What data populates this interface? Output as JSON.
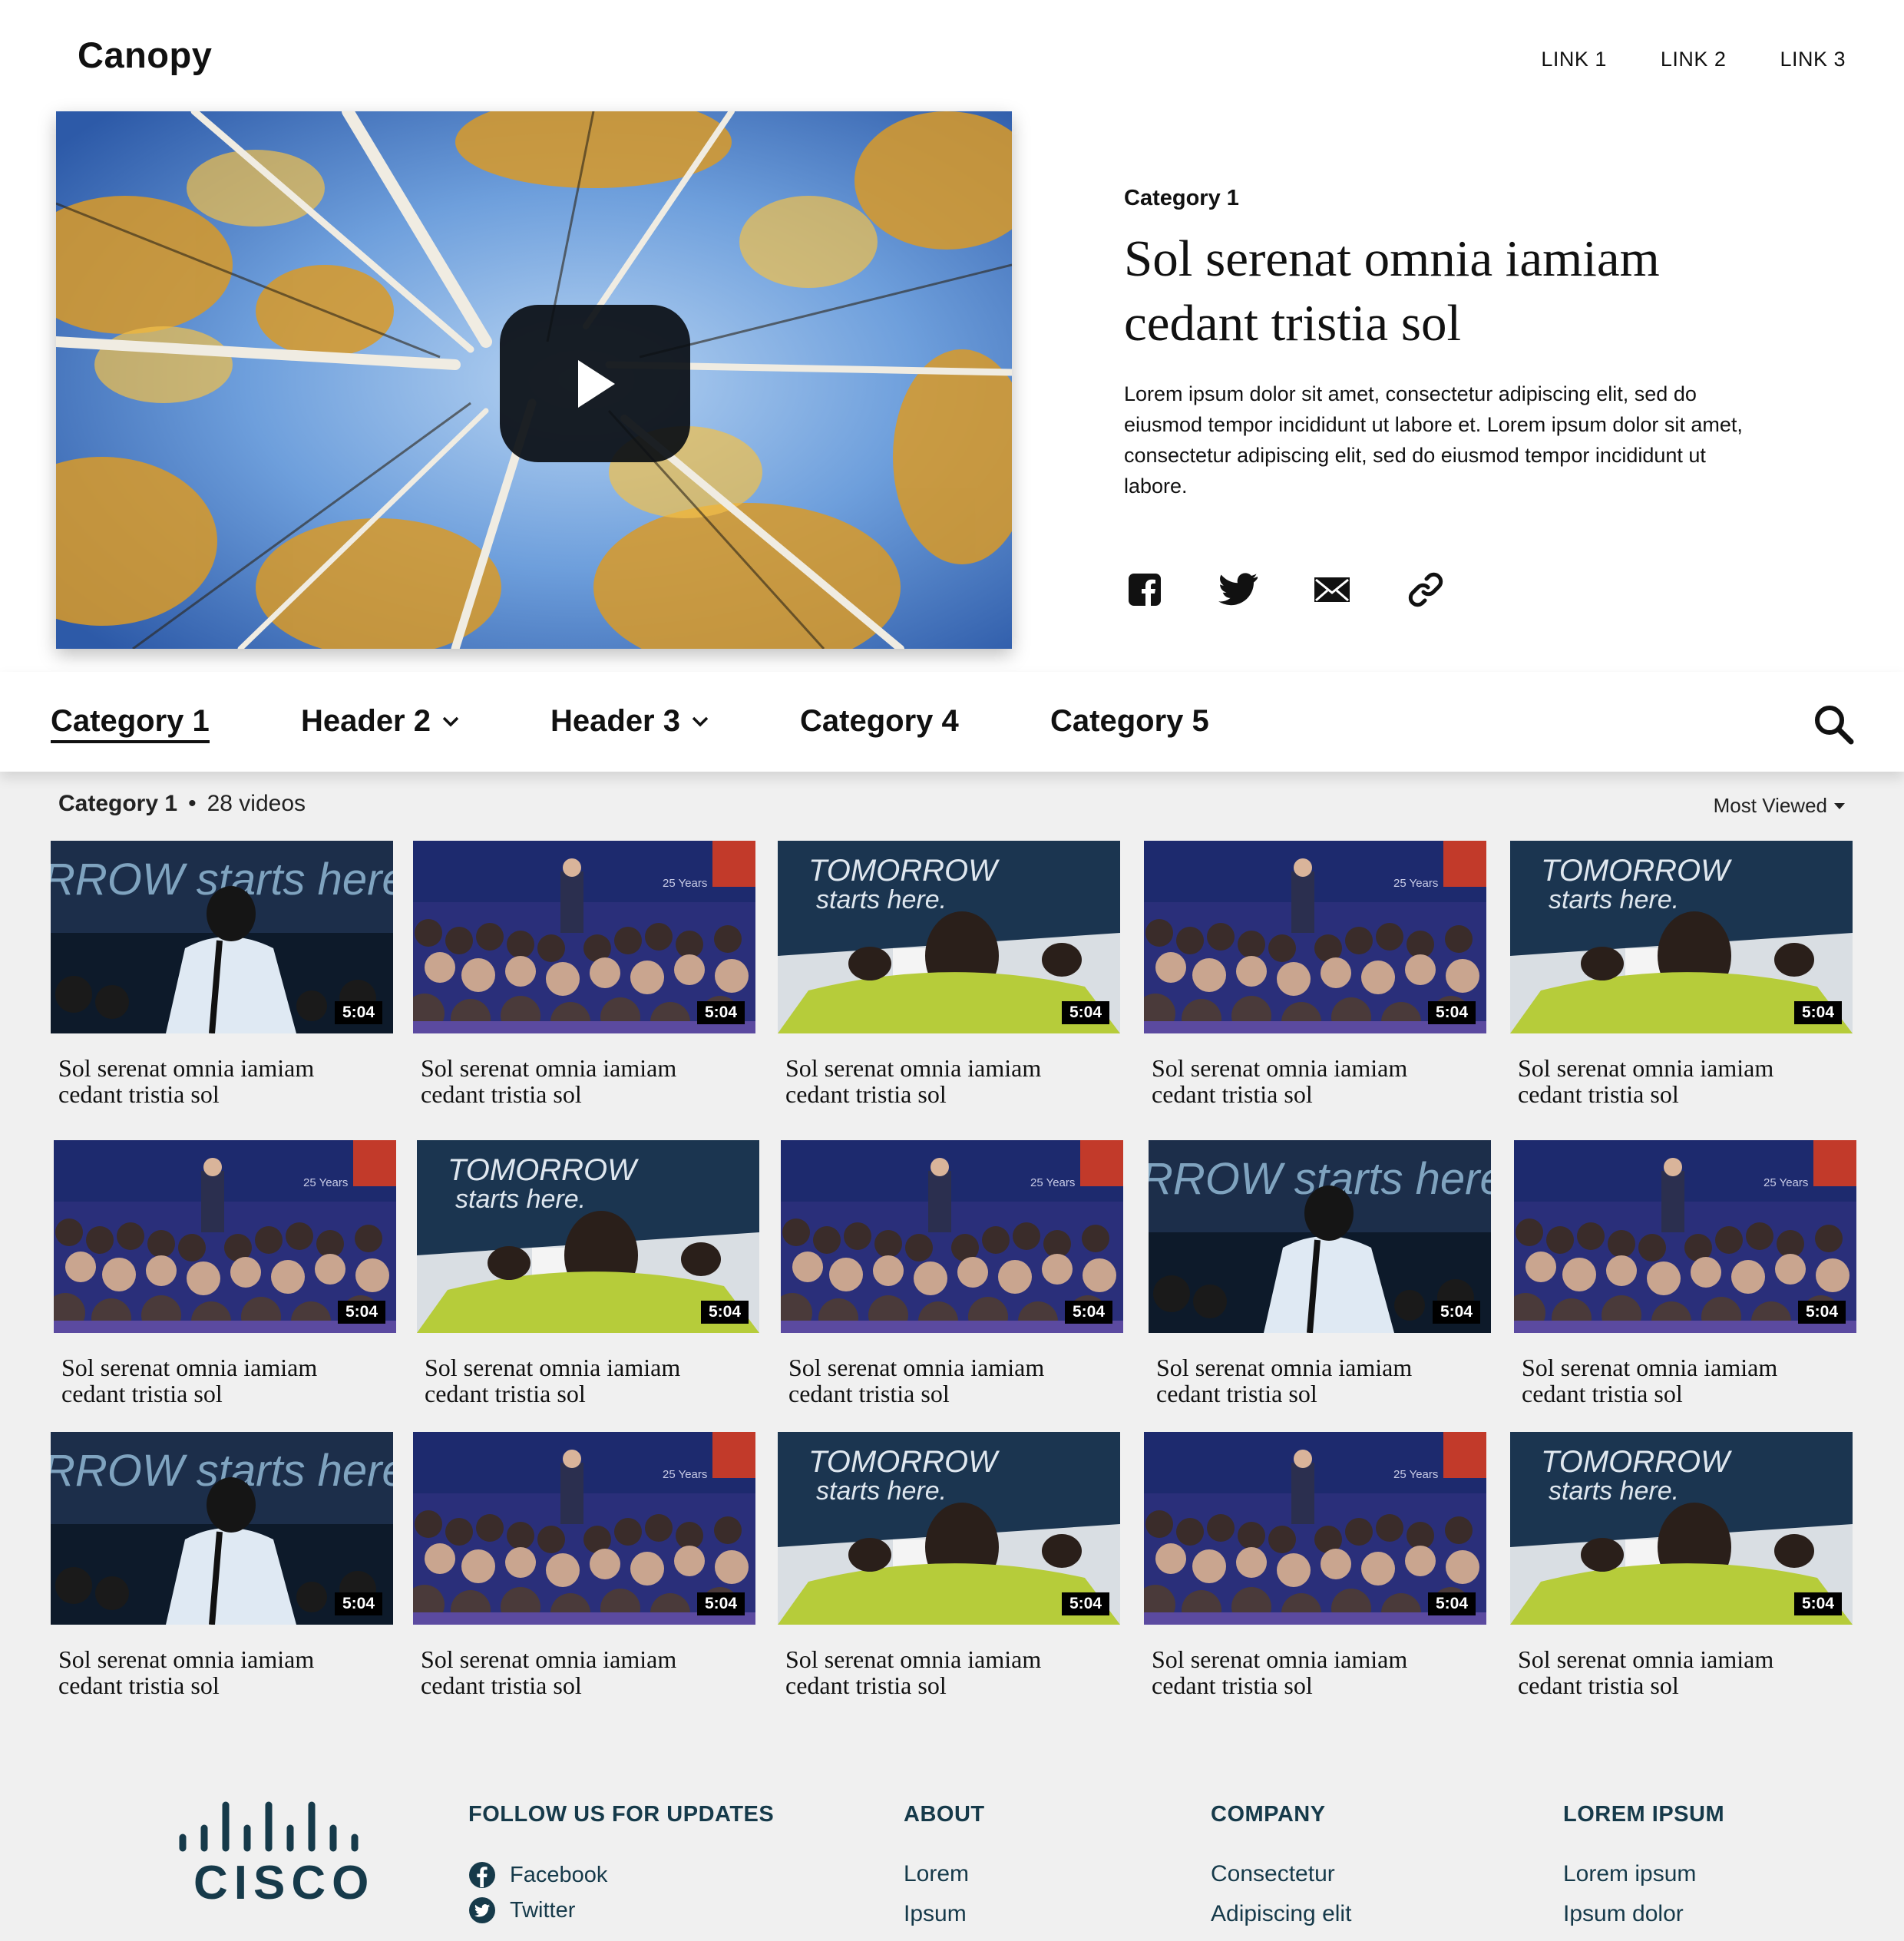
{
  "header": {
    "logo": "Canopy",
    "links": [
      "LINK 1",
      "LINK 2",
      "LINK 3"
    ]
  },
  "hero": {
    "category": "Category 1",
    "title": "Sol serenat omnia iamiam cedant tristia sol",
    "description": "Lorem ipsum dolor sit amet, consectetur adipiscing elit, sed do eiusmod tempor incididunt ut labore et. Lorem ipsum dolor sit amet, consectetur adipiscing elit, sed do eiusmod tempor incididunt ut labore.",
    "share_icons": [
      "facebook-icon",
      "twitter-icon",
      "email-icon",
      "link-icon"
    ]
  },
  "nav": {
    "items": [
      "Category 1",
      "Header 2",
      "Header 3",
      "Category 4",
      "Category 5"
    ],
    "active": "Category 1"
  },
  "listing": {
    "category": "Category 1",
    "separator": "•",
    "count": "28 videos",
    "sort": "Most Viewed"
  },
  "videos": [
    {
      "title": "Sol serenat omnia iamiam cedant tristia sol",
      "duration": "5:04",
      "thumb": "presenter-walk"
    },
    {
      "title": "Sol serenat omnia iamiam cedant tristia sol",
      "duration": "5:04",
      "thumb": "crowd-stage"
    },
    {
      "title": "Sol serenat omnia iamiam cedant tristia sol",
      "duration": "5:04",
      "thumb": "tomorrow-banner"
    },
    {
      "title": "Sol serenat omnia iamiam cedant tristia sol",
      "duration": "5:04",
      "thumb": "crowd-stage"
    },
    {
      "title": "Sol serenat omnia iamiam cedant tristia sol",
      "duration": "5:04",
      "thumb": "tomorrow-banner"
    },
    {
      "title": "Sol serenat omnia iamiam cedant tristia sol",
      "duration": "5:04",
      "thumb": "crowd-stage"
    },
    {
      "title": "Sol serenat omnia iamiam cedant tristia sol",
      "duration": "5:04",
      "thumb": "tomorrow-banner"
    },
    {
      "title": "Sol serenat omnia iamiam cedant tristia sol",
      "duration": "5:04",
      "thumb": "crowd-stage"
    },
    {
      "title": "Sol serenat omnia iamiam cedant tristia sol",
      "duration": "5:04",
      "thumb": "presenter-walk"
    },
    {
      "title": "Sol serenat omnia iamiam cedant tristia sol",
      "duration": "5:04",
      "thumb": "crowd-stage"
    },
    {
      "title": "Sol serenat omnia iamiam cedant tristia sol",
      "duration": "5:04",
      "thumb": "presenter-walk"
    },
    {
      "title": "Sol serenat omnia iamiam cedant tristia sol",
      "duration": "5:04",
      "thumb": "crowd-stage"
    },
    {
      "title": "Sol serenat omnia iamiam cedant tristia sol",
      "duration": "5:04",
      "thumb": "tomorrow-banner"
    },
    {
      "title": "Sol serenat omnia iamiam cedant tristia sol",
      "duration": "5:04",
      "thumb": "crowd-stage"
    },
    {
      "title": "Sol serenat omnia iamiam cedant tristia sol",
      "duration": "5:04",
      "thumb": "tomorrow-banner"
    }
  ],
  "thumb_text": {
    "banner_line1": "TOMORROW",
    "banner_line2": "starts here.",
    "walk_banner": "RROW starts here",
    "anniversary": "25 Years"
  },
  "footer": {
    "logo_text": "CISCO",
    "follow": {
      "heading": "FOLLOW US FOR UPDATES",
      "items": [
        "Facebook",
        "Twitter"
      ]
    },
    "about": {
      "heading": "ABOUT",
      "items": [
        "Lorem",
        "Ipsum"
      ]
    },
    "company": {
      "heading": "COMPANY",
      "items": [
        "Consectetur",
        "Adipiscing elit"
      ]
    },
    "lorem": {
      "heading": "LOREM IPSUM",
      "items": [
        "Lorem ipsum",
        "Ipsum dolor"
      ]
    }
  },
  "colors": {
    "footer_text": "#163a4a",
    "accent_video_green": "#b6cc3a",
    "stage_blue": "#1d2a6e"
  }
}
